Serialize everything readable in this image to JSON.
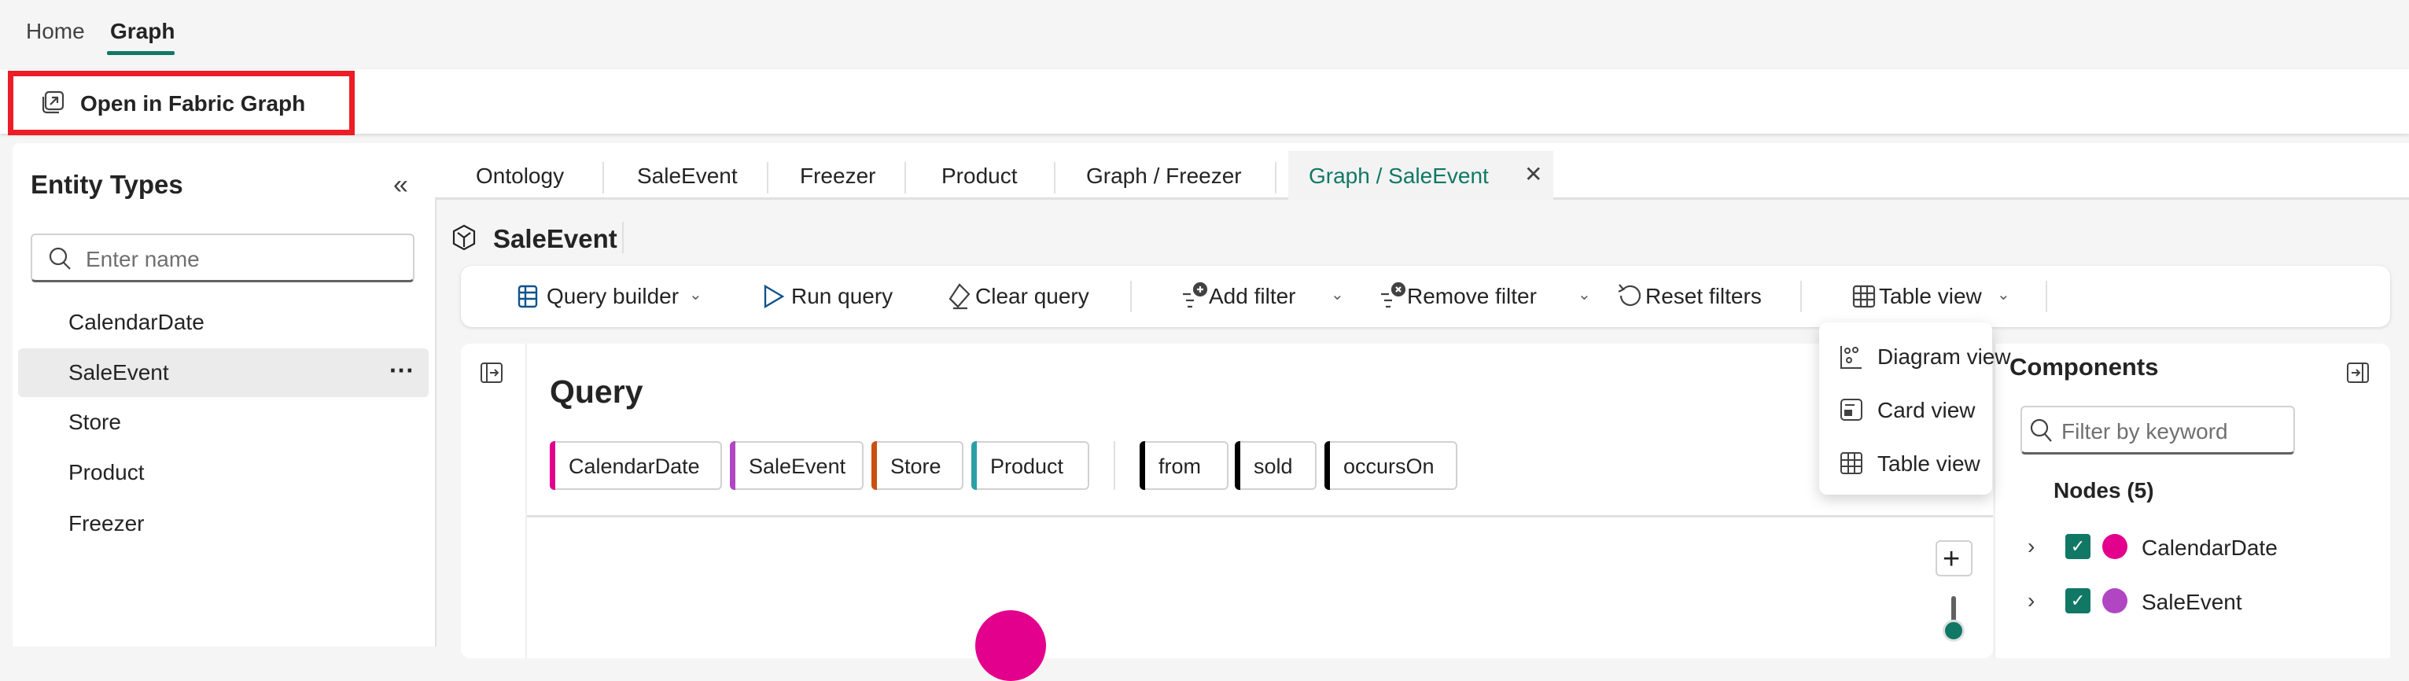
{
  "top_tabs": [
    {
      "label": "Home"
    },
    {
      "label": "Graph",
      "active": true
    }
  ],
  "toolbar": {
    "open_fabric_graph": "Open in Fabric Graph"
  },
  "sidebar": {
    "title": "Entity Types",
    "search_placeholder": "Enter name",
    "items": [
      {
        "label": "CalendarDate"
      },
      {
        "label": "SaleEvent",
        "selected": true
      },
      {
        "label": "Store"
      },
      {
        "label": "Product"
      },
      {
        "label": "Freezer"
      }
    ]
  },
  "tabs": [
    {
      "label": "Ontology"
    },
    {
      "label": "SaleEvent"
    },
    {
      "label": "Freezer"
    },
    {
      "label": "Product"
    },
    {
      "label": "Graph / Freezer"
    },
    {
      "label": "Graph / SaleEvent",
      "active": true
    }
  ],
  "entity_title": "SaleEvent",
  "commands": {
    "query_builder": "Query builder",
    "run_query": "Run query",
    "clear_query": "Clear query",
    "add_filter": "Add filter",
    "remove_filter": "Remove filter",
    "reset_filters": "Reset filters",
    "table_view": "Table view"
  },
  "view_menu": [
    {
      "label": "Diagram view"
    },
    {
      "label": "Card view"
    },
    {
      "label": "Table view"
    }
  ],
  "query": {
    "title": "Query",
    "node_chips": [
      {
        "label": "CalendarDate",
        "color": "#e3008c"
      },
      {
        "label": "SaleEvent",
        "color": "#b146c2"
      },
      {
        "label": "Store",
        "color": "#ca5010"
      },
      {
        "label": "Product",
        "color": "#2aa0a4"
      }
    ],
    "edge_chips": [
      {
        "label": "from",
        "color": "#000000"
      },
      {
        "label": "sold",
        "color": "#000000"
      },
      {
        "label": "occursOn",
        "color": "#000000"
      }
    ]
  },
  "components": {
    "title": "Components",
    "filter_placeholder": "Filter by keyword",
    "nodes_header": "Nodes (5)",
    "nodes": [
      {
        "label": "CalendarDate",
        "color": "#e3008c",
        "checked": true
      },
      {
        "label": "SaleEvent",
        "color": "#b146c2",
        "checked": true
      }
    ]
  },
  "colors": {
    "accent": "#117865",
    "highlight": "#ee1c25"
  }
}
